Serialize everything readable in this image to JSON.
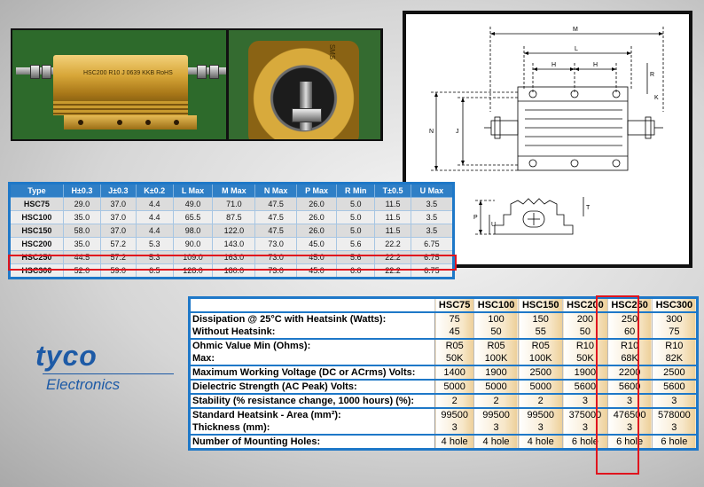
{
  "photo": {
    "body_text": "HSC200 R10  J  0639 KKB RoHS",
    "end_text": "SMS"
  },
  "dimension_table": {
    "headers": [
      "Type",
      "H±0.3",
      "J±0.3",
      "K±0.2",
      "L Max",
      "M Max",
      "N Max",
      "P Max",
      "R Min",
      "T±0.5",
      "U Max"
    ],
    "rows": [
      [
        "HSC75",
        "29.0",
        "37.0",
        "4.4",
        "49.0",
        "71.0",
        "47.5",
        "26.0",
        "5.0",
        "11.5",
        "3.5"
      ],
      [
        "HSC100",
        "35.0",
        "37.0",
        "4.4",
        "65.5",
        "87.5",
        "47.5",
        "26.0",
        "5.0",
        "11.5",
        "3.5"
      ],
      [
        "HSC150",
        "58.0",
        "37.0",
        "4.4",
        "98.0",
        "122.0",
        "47.5",
        "26.0",
        "5.0",
        "11.5",
        "3.5"
      ],
      [
        "HSC200",
        "35.0",
        "57.2",
        "5.3",
        "90.0",
        "143.0",
        "73.0",
        "45.0",
        "5.6",
        "22.2",
        "6.75"
      ],
      [
        "HSC250",
        "44.5",
        "57.2",
        "5.3",
        "109.0",
        "163.0",
        "73.0",
        "45.0",
        "5.6",
        "22.2",
        "6.75"
      ],
      [
        "HSC300",
        "52.0",
        "59.0",
        "6.5",
        "128.0",
        "180.0",
        "73.0",
        "45.0",
        "6.0",
        "22.2",
        "6.75"
      ]
    ],
    "highlight_color": "#e0141e"
  },
  "drawing_labels": {
    "m": "M",
    "l": "L",
    "h1": "H",
    "h2": "H",
    "r": "R",
    "n": "N",
    "j": "J",
    "k": "K",
    "p": "P",
    "u": "U",
    "t": "T"
  },
  "logo": {
    "mark": "tyco",
    "sub": "Electronics",
    "color": "#1d5aa6"
  },
  "spec_table": {
    "models": [
      "HSC75",
      "HSC100",
      "HSC150",
      "HSC200",
      "HSC250",
      "HSC300"
    ],
    "rows": [
      {
        "label": "Dissipation @ 25°C with Heatsink (Watts):",
        "values": [
          "75",
          "100",
          "150",
          "200",
          "250",
          "300"
        ],
        "group_start": true
      },
      {
        "label": "Without Heatsink:",
        "values": [
          "45",
          "50",
          "55",
          "50",
          "60",
          "75"
        ]
      },
      {
        "label": "Ohmic Value Min (Ohms):",
        "values": [
          "R05",
          "R05",
          "R05",
          "R10",
          "R10",
          "R10"
        ],
        "group_start": true
      },
      {
        "label": "Max:",
        "values": [
          "50K",
          "100K",
          "100K",
          "50K",
          "68K",
          "82K"
        ]
      },
      {
        "label": "Maximum Working Voltage (DC or ACrms) Volts:",
        "values": [
          "1400",
          "1900",
          "2500",
          "1900",
          "2200",
          "2500"
        ],
        "group_start": true
      },
      {
        "label": "Dielectric Strength (AC Peak) Volts:",
        "values": [
          "5000",
          "5000",
          "5000",
          "5600",
          "5600",
          "5600"
        ],
        "group_start": true
      },
      {
        "label": "Stability (% resistance change, 1000 hours) (%):",
        "values": [
          "2",
          "2",
          "2",
          "3",
          "3",
          "3"
        ],
        "group_start": true
      },
      {
        "label": "Standard Heatsink - Area (mm²):",
        "values": [
          "99500",
          "99500",
          "99500",
          "375000",
          "476500",
          "578000"
        ],
        "group_start": true
      },
      {
        "label": "Thickness (mm):",
        "values": [
          "3",
          "3",
          "3",
          "3",
          "3",
          "3"
        ]
      },
      {
        "label": "Number of Mounting Holes:",
        "values": [
          "4 hole",
          "4 hole",
          "4 hole",
          "6 hole",
          "6 hole",
          "6 hole"
        ],
        "group_start": true
      }
    ]
  }
}
